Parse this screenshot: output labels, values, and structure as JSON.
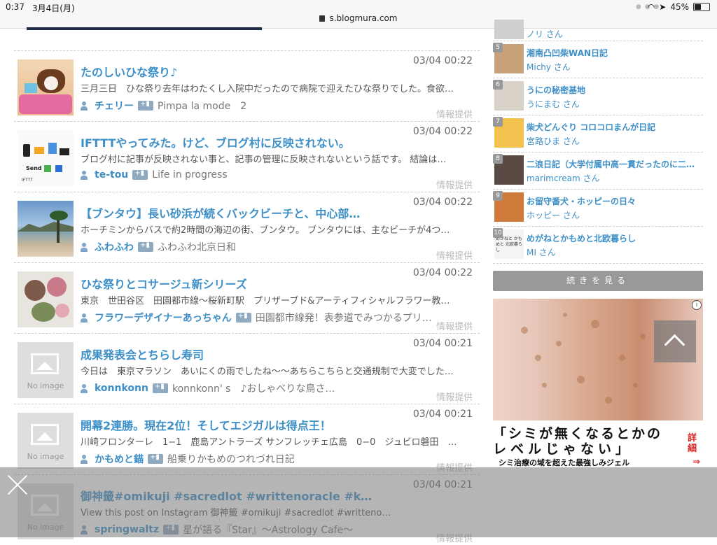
{
  "statusbar": {
    "time": "0:37",
    "date": "3月4日(月)",
    "url": "s.blogmura.com",
    "battery": "45%",
    "battery_level": 0.45
  },
  "posts": [
    {
      "time": "03/04 00:22",
      "title": "たのしいひな祭り♪",
      "excerpt": "三月三日　ひな祭り去年はわたくし入院中だったので病院で迎えたひな祭りでした。食欲…",
      "user": "チェリー",
      "blog": "Pimpa la mode　2",
      "info": "情報提供",
      "thumb": "dog"
    },
    {
      "time": "03/04 00:22",
      "title": "IFTTTやってみた。けど、ブログ村に反映されない。",
      "excerpt": "ブログ村に記事が反映されない事と、記事の管理に反映されないという話です。 結論は…",
      "user": "te-tou",
      "blog": "Life in progress",
      "info": "情報提供",
      "thumb": "ifttt",
      "thumb_text": "Send",
      "thumb_caption": "IFTTT"
    },
    {
      "time": "03/04 00:22",
      "title": "【ブンタウ】長い砂浜が続くバックビーチと、中心部…",
      "excerpt": "ホーチミンからバスで約2時間の海辺の街、ブンタウ。 ブンタウには、主なビーチが4つ…",
      "user": "ふわふわ",
      "blog": "ふわふわ北京日和",
      "info": "情報提供",
      "thumb": "beach"
    },
    {
      "time": "03/04 00:22",
      "title": "ひな祭りとコサージュ新シリーズ",
      "excerpt": "東京　世田谷区　田園都市線〜桜新町駅　プリザーブド&アーティフィシャルフラワー教…",
      "user": "フラワーデザイナーあっちゃん",
      "blog": "田園都市線発！表参道でみつかるプリ…",
      "info": "情報提供",
      "thumb": "flowers"
    },
    {
      "time": "03/04 00:21",
      "title": "成果発表会とちらし寿司",
      "excerpt": "今日は　東京マラソン　あいにくの雨でしたね〜〜あちらこちらと交通規制で大変でした…",
      "user": "konnkonn",
      "blog": "konnkonn' s　♪おしゃべりな鳥さ…",
      "info": "情報提供",
      "thumb": "noimage",
      "noimage_text": "No image"
    },
    {
      "time": "03/04 00:21",
      "title": "開幕2連勝。現在2位！そしてエジガルは得点王！",
      "excerpt": "川崎フロンターレ　1−1　鹿島アントラーズ サンフレッチェ広島　0−0　ジュビロ磐田　…",
      "user": "かもめと錨",
      "blog": "船乗りかもめのつれづれ日記",
      "info": "情報提供",
      "thumb": "noimage",
      "noimage_text": "No image"
    },
    {
      "time": "03/04 00:21",
      "title": "御神籤#omikuji #sacredlot #writtenoracle #ke…",
      "excerpt": "View this post on Instagram 御神籤 #omikuji #sacredlot #writteno…",
      "user": "springwaltz",
      "blog": "星が語る『Star』〜Astrology Cafe〜",
      "info": "情報提供",
      "thumb": "noimage",
      "noimage_text": "No image"
    }
  ],
  "ranking": [
    {
      "rank": "",
      "title": "",
      "user": "ノリ さん",
      "color": "#cfcfcf"
    },
    {
      "rank": "5",
      "title": "湘南凸凹柴WAN日記",
      "user": "Michy さん",
      "color": "#c7a27a"
    },
    {
      "rank": "6",
      "title": "うにの秘密基地",
      "user": "うにまむ さん",
      "color": "#d9d2c9"
    },
    {
      "rank": "7",
      "title": "柴犬どんぐり コロコロまんが日記",
      "user": "宮路ひま さん",
      "color": "#f2c14e"
    },
    {
      "rank": "8",
      "title": "二浪日記（大学付属中高一貫だったのに二…",
      "user": "marimcream さん",
      "color": "#5a4a44"
    },
    {
      "rank": "9",
      "title": "お留守番犬・ホッピーの日々",
      "user": "ホッピー さん",
      "color": "#d07a3a"
    },
    {
      "rank": "10",
      "title": "めがねとかもめと北欧暮らし",
      "user": "MI さん",
      "color": "#f4f4f4",
      "avatar_text": "めがねと かもめと 北欧暮らし"
    }
  ],
  "more_label": "続きを見る",
  "ad": {
    "line1": "「シミが無くなるとかの",
    "line2": "レベルじゃない」",
    "line3": "シミ治療の域を超えた最強しみジェル",
    "detail": "詳細",
    "arrow": "⇒"
  }
}
